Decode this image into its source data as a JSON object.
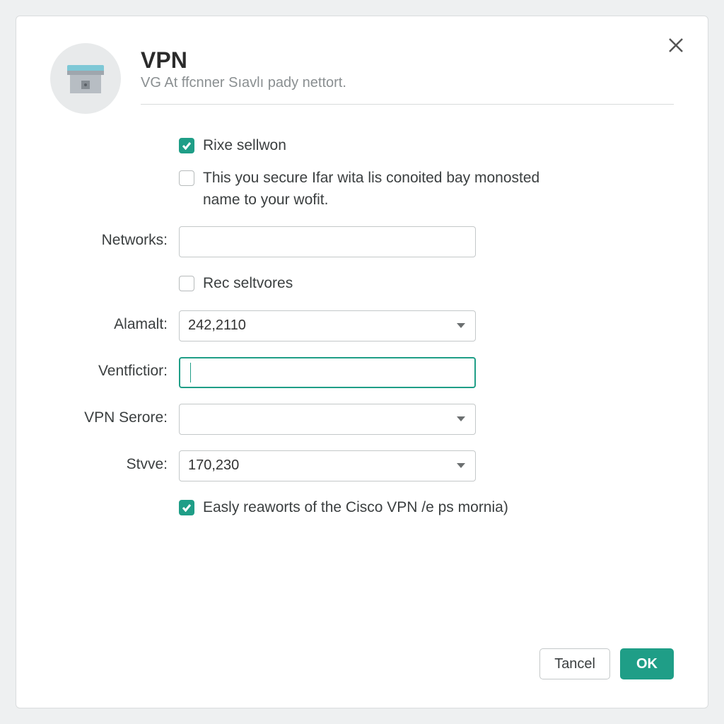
{
  "header": {
    "title": "VPN",
    "subtitle": "VG At ffᴄnner Sıavlı pady nettort."
  },
  "checkboxes": {
    "rixe": {
      "label": "Rixe sellwon",
      "checked": true
    },
    "secure": {
      "label": "This you secure Ifar wita lis conoited bay monosted name to your wofit.",
      "checked": false
    },
    "rec": {
      "label": "Rec seltvores",
      "checked": false
    },
    "easly": {
      "label": "Easly reaworts of the Cisco VPN /e ps mornia)",
      "checked": true
    }
  },
  "fields": {
    "networks": {
      "label": "Networks:",
      "value": ""
    },
    "alamalt": {
      "label": "Alamalt:",
      "value": "242,2110"
    },
    "ventfictior": {
      "label": "Ventfictior:",
      "value": ""
    },
    "vpnserore": {
      "label": "VPN Serore:",
      "value": ""
    },
    "stvve": {
      "label": "Stvve:",
      "value": "170,230"
    }
  },
  "buttons": {
    "cancel": "Tancel",
    "ok": "OK"
  },
  "colors": {
    "accent": "#1f9e87"
  }
}
